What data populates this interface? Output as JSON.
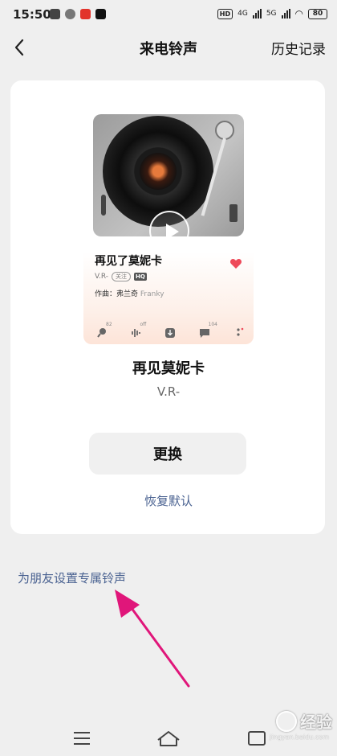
{
  "status_bar": {
    "time": "15:50",
    "network_badge": "HD",
    "signal_1": "4G",
    "signal_2": "5G",
    "battery": "80"
  },
  "header": {
    "title": "来电铃声",
    "history": "历史记录"
  },
  "card": {
    "song_title": "再见了莫妮卡",
    "artist": "V.R-",
    "follow": "关注",
    "quality": "HQ",
    "composer_label": "作曲：",
    "composer_name": "弗兰奇",
    "composer_alias": "Franky",
    "actions": [
      {
        "icon": "comment-mic-icon",
        "count": "82"
      },
      {
        "icon": "waveform-icon",
        "count": "off"
      },
      {
        "icon": "download-icon",
        "count": ""
      },
      {
        "icon": "chat-bubble-icon",
        "count": "104"
      },
      {
        "icon": "more-icon",
        "count": ""
      }
    ]
  },
  "ringtone": {
    "name": "再见莫妮卡",
    "artist": "V.R-",
    "change_label": "更换",
    "restore_label": "恢复默认"
  },
  "friends_link": "为朋友设置专属铃声",
  "watermark": {
    "text": "经验",
    "small": "jingyan.baidu.com"
  },
  "colors": {
    "link": "#4a6291",
    "arrow": "#e0167a",
    "heart": "#ee4a5a"
  }
}
